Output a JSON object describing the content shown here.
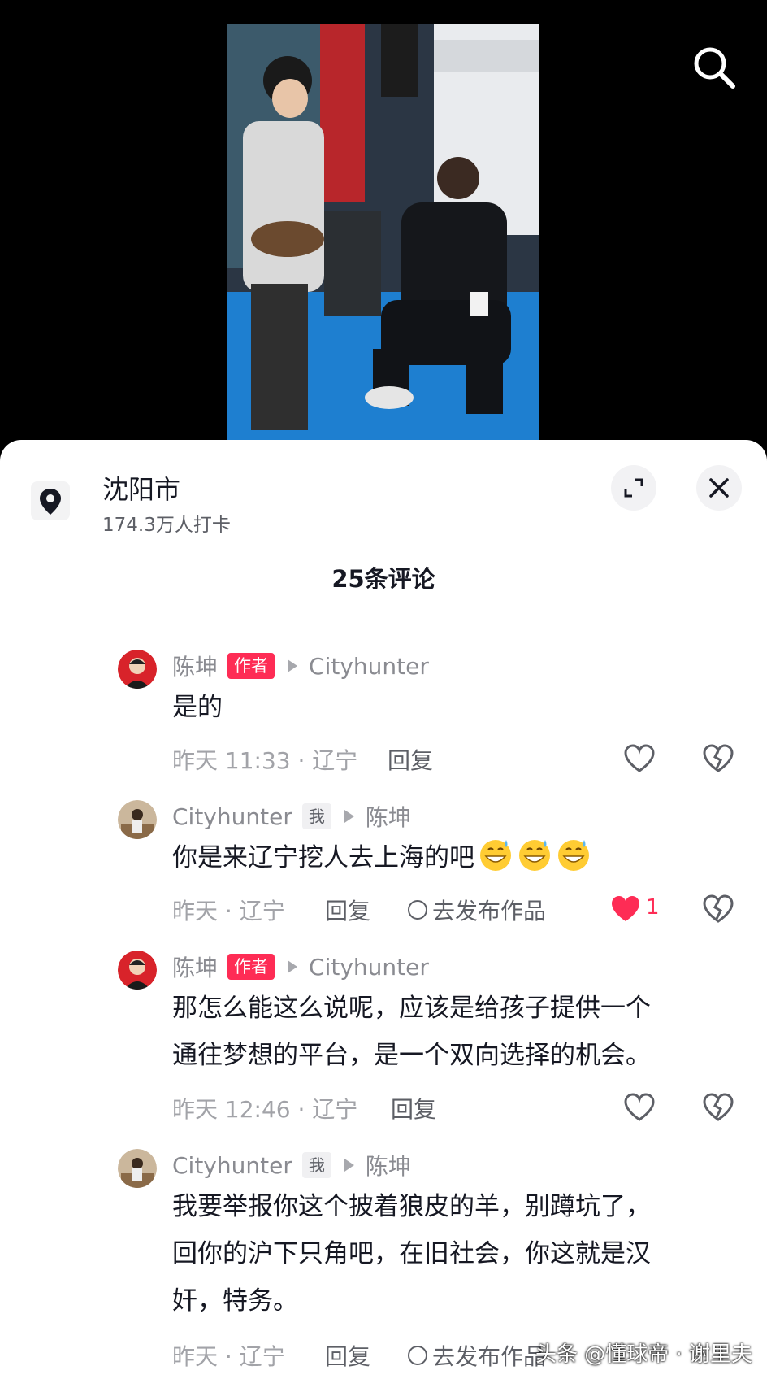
{
  "location": {
    "name": "沈阳市",
    "checkins": "174.3万人打卡"
  },
  "comments_header": {
    "count_label": "25条评论"
  },
  "comments": [
    {
      "user": "陈坤",
      "badge": "作者",
      "reply_to": "Cityhunter",
      "text": "是的",
      "meta": "昨天 11:33 · 辽宁",
      "reply_label": "回复"
    },
    {
      "user": "Cityhunter",
      "badge": "我",
      "reply_to": "陈坤",
      "text": "你是来辽宁挖人去上海的吧",
      "meta": "昨天 · 辽宁",
      "reply_label": "回复",
      "publish_label": "去发布作品",
      "likes": "1"
    },
    {
      "user": "陈坤",
      "badge": "作者",
      "reply_to": "Cityhunter",
      "text_line1": "那怎么能这么说呢，应该是给孩子提供一个",
      "text_line2": "通往梦想的平台，是一个双向选择的机会。",
      "meta": "昨天 12:46 · 辽宁",
      "reply_label": "回复"
    },
    {
      "user": "Cityhunter",
      "badge": "我",
      "reply_to": "陈坤",
      "text_line1": "我要举报你这个披着狼皮的羊，别蹲坑了，",
      "text_line2": "回你的沪下只角吧，在旧社会，你这就是汉",
      "text_line3": "奸，特务。",
      "meta": "昨天 · 辽宁",
      "reply_label": "回复",
      "publish_label": "去发布作品"
    }
  ],
  "watermark": "头条 @懂球帝 · 谢里夫",
  "colors": {
    "accent": "#fe2c55",
    "text_primary": "#161823",
    "text_secondary": "#a2a3a8"
  },
  "icons": [
    "search-icon",
    "location-pin-icon",
    "expand-icon",
    "close-icon",
    "heart-icon",
    "dislike-icon",
    "share-circle-icon"
  ]
}
